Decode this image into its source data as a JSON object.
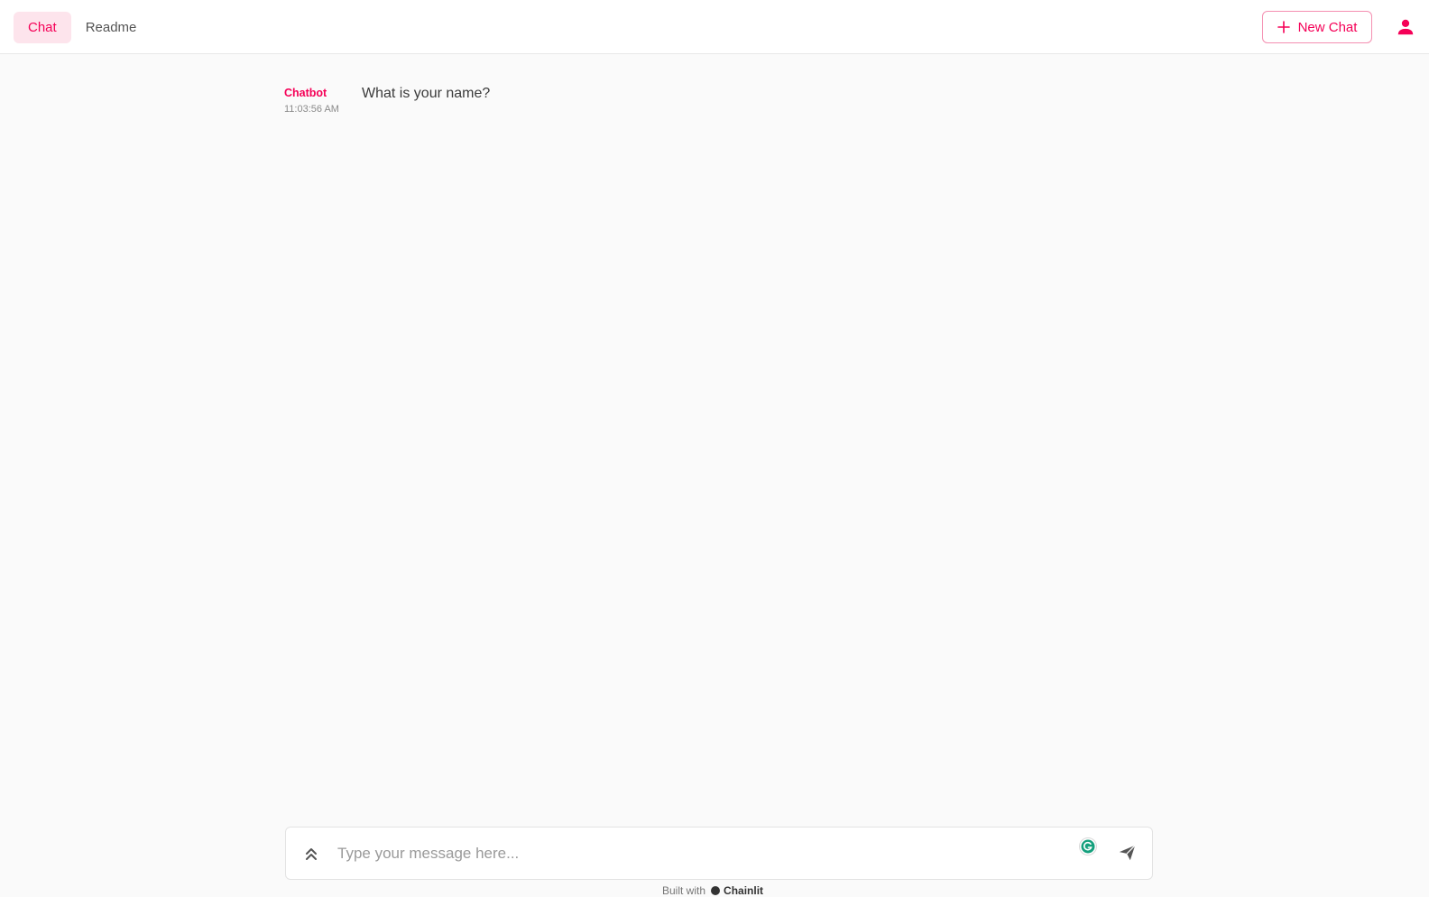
{
  "header": {
    "tabs": [
      {
        "label": "Chat",
        "active": true
      },
      {
        "label": "Readme",
        "active": false
      }
    ],
    "new_chat_label": "New Chat",
    "user_icon": "user-icon",
    "accent_color": "#f50057"
  },
  "messages": [
    {
      "author": "Chatbot",
      "time": "11:03:56 AM",
      "content": "What is your name?"
    }
  ],
  "composer": {
    "placeholder": "Type your message here...",
    "value": "",
    "icons": [
      "double-chevron-up-icon",
      "grammarly-icon",
      "send-icon"
    ]
  },
  "footer": {
    "built_with": "Built with",
    "brand": "Chainlit"
  }
}
